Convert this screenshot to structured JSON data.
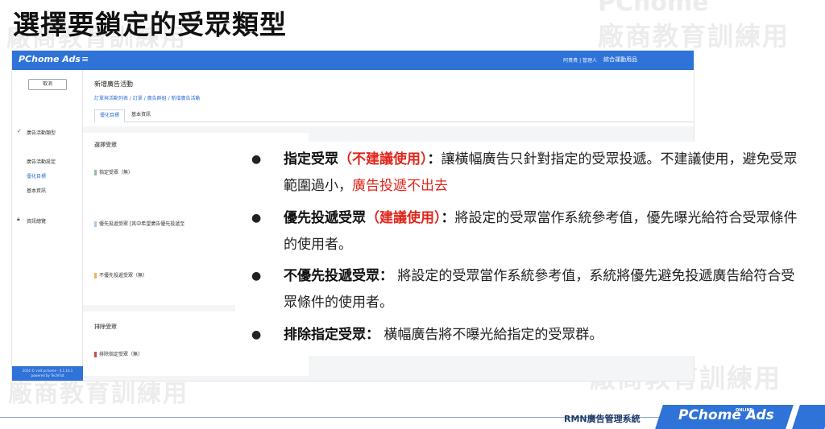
{
  "slide": {
    "title": "選擇要鎖定的受眾類型",
    "watermark": "廠商教育訓練用",
    "watermark_brand": "PChome"
  },
  "app": {
    "logo": "PChome Ads",
    "menu_icon": "hamburger-icon",
    "user_info": "阿貴貴 | 管理人",
    "store_name": "綜合運動用品",
    "sidebar": {
      "cancel_label": "取消",
      "section_ad_type": "廣告活動類型",
      "section_ad_settings": "廣告活動設定",
      "item_optimization": "優化目標",
      "item_basic": "基本資訊",
      "section_overview": "資訊總覽",
      "footer_line1": "2024 © visit pchome · 0.1.10.1",
      "footer_line2": "powered by TechFlat"
    },
    "header": {
      "page_heading": "新增廣告活動",
      "breadcrumb": "訂單與活動列表 / 訂單 / 廣告群組 / 新增廣告活動",
      "tab_active": "優化目標",
      "tab_inactive": "基本資訊"
    },
    "select_audience": {
      "title": "選擇受眾",
      "rows": [
        {
          "label": "指定受眾（無）",
          "color": "#8fbf9a"
        },
        {
          "label": "優先投遞受眾 [其中希望廣告優先投遞至",
          "color": "#a9cbe8"
        },
        {
          "label": "不優先投遞受眾（無）",
          "color": "#f0b35a"
        }
      ]
    },
    "exclude_audience": {
      "title": "排除受眾",
      "row": {
        "label": "排除指定受眾（無）",
        "color": "#c94a4a"
      }
    }
  },
  "bullets": [
    {
      "keyword": "指定受眾",
      "note": "（不建議使用）",
      "colon": "：",
      "text": "讓橫幅廣告只針對指定的受眾投遞。不建議使用，避免受眾範圍過小，",
      "warning": "廣告投遞不出去"
    },
    {
      "keyword": "優先投遞受眾",
      "note": "（建議使用）",
      "colon": "：",
      "text": "將設定的受眾當作系統參考值，優先曝光給符合受眾條件的使用者。"
    },
    {
      "keyword": "不優先投遞受眾",
      "colon": "：",
      "text": "將設定的受眾當作系統參考值，系統將優先避免投遞廣告給符合受眾條件的使用者。"
    },
    {
      "keyword": "排除指定受眾",
      "colon": "：",
      "text": "橫幅廣告將不曝光給指定的受眾群。"
    }
  ],
  "footer": {
    "system_name": "RMN廣告管理系統",
    "logo_text": "PChome Ads",
    "logo_super": "ONLINE",
    "brand_color": "#2f73d8"
  }
}
